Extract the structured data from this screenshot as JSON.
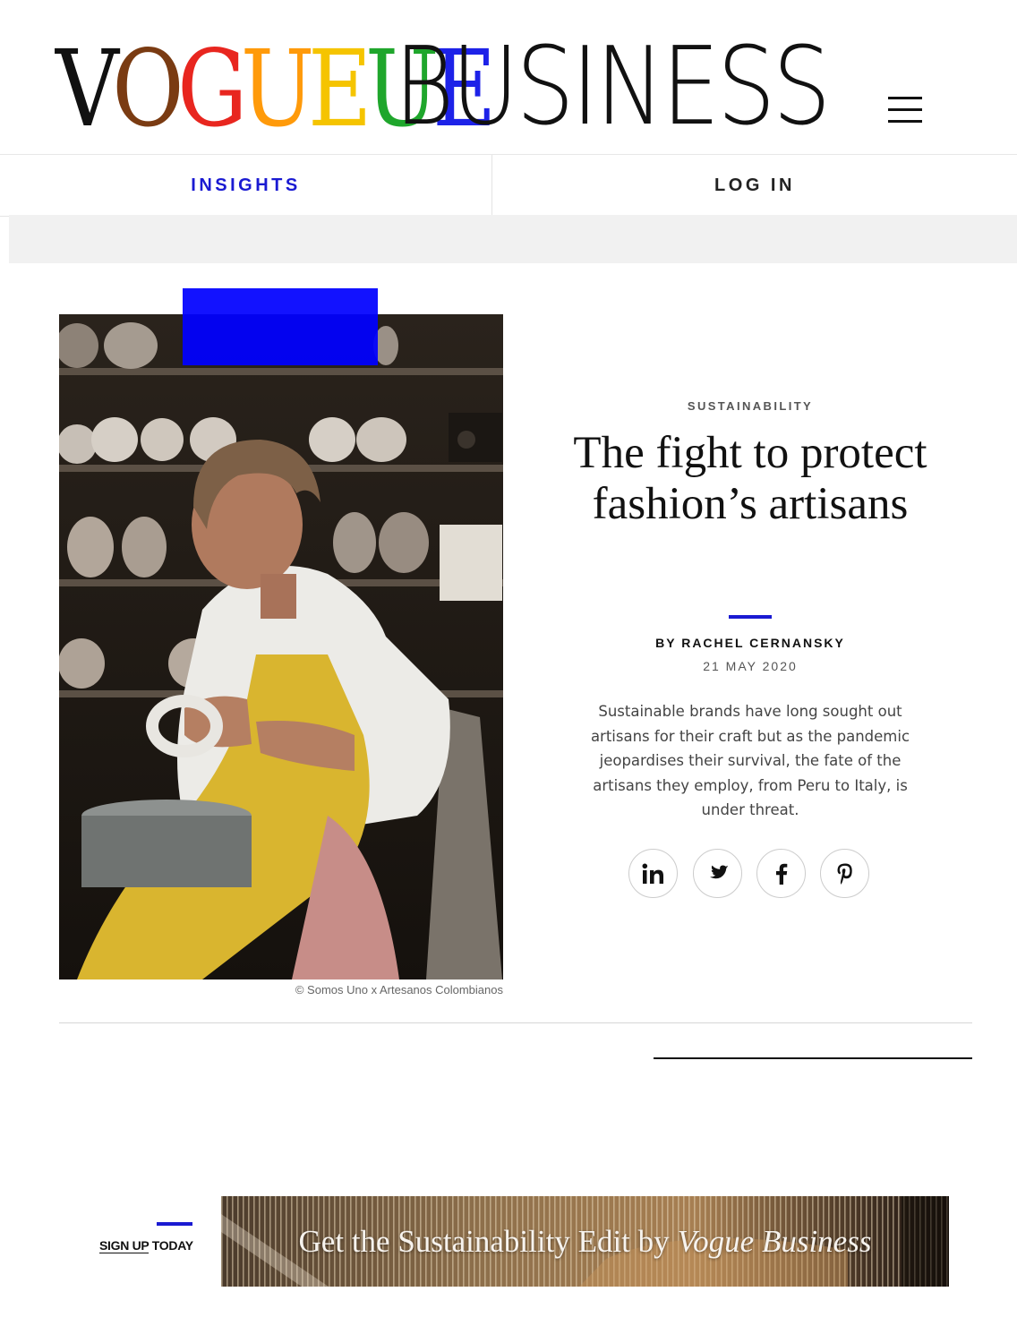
{
  "brand": {
    "vogue_letters": [
      {
        "char": "V",
        "color": "#111111"
      },
      {
        "char": "O",
        "color": "#7a3b12"
      },
      {
        "char": "G",
        "color": "#e8261f"
      },
      {
        "char": "U",
        "color": "#ff9a0a"
      },
      {
        "char": "E",
        "color": "#f5c400"
      },
      {
        "char": "U",
        "color": "#1fa62c"
      },
      {
        "char": "E",
        "color": "#1d22e8"
      }
    ],
    "business": "BUSINESS"
  },
  "header": {
    "menu_icon": "hamburger-menu-icon"
  },
  "nav": {
    "insights": "INSIGHTS",
    "login": "LOG IN"
  },
  "article": {
    "category": "SUSTAINABILITY",
    "title": "The fight to protect fashion’s artisans",
    "byline": "BY RACHEL CERNANSKY",
    "date": "21 MAY 2020",
    "dek": "Sustainable brands have long sought out artisans for their craft but as the pandemic jeopardises their survival, the fate of the artisans they employ, from Peru to Italy, is under threat.",
    "image_credit": "© Somos Uno x Artesanos Colombianos",
    "share_icons": [
      "linkedin-icon",
      "twitter-icon",
      "facebook-icon",
      "pinterest-icon"
    ]
  },
  "signup": {
    "label_underlined": "SIGN UP",
    "label_rest": " TODAY",
    "banner_text": "Get the Sustainability Edit by",
    "banner_brand": "Vogue Business"
  },
  "colors": {
    "accent": "#1a1ad2",
    "overlay_blue": "#0000ff",
    "ad_band": "#f1f1f1"
  }
}
